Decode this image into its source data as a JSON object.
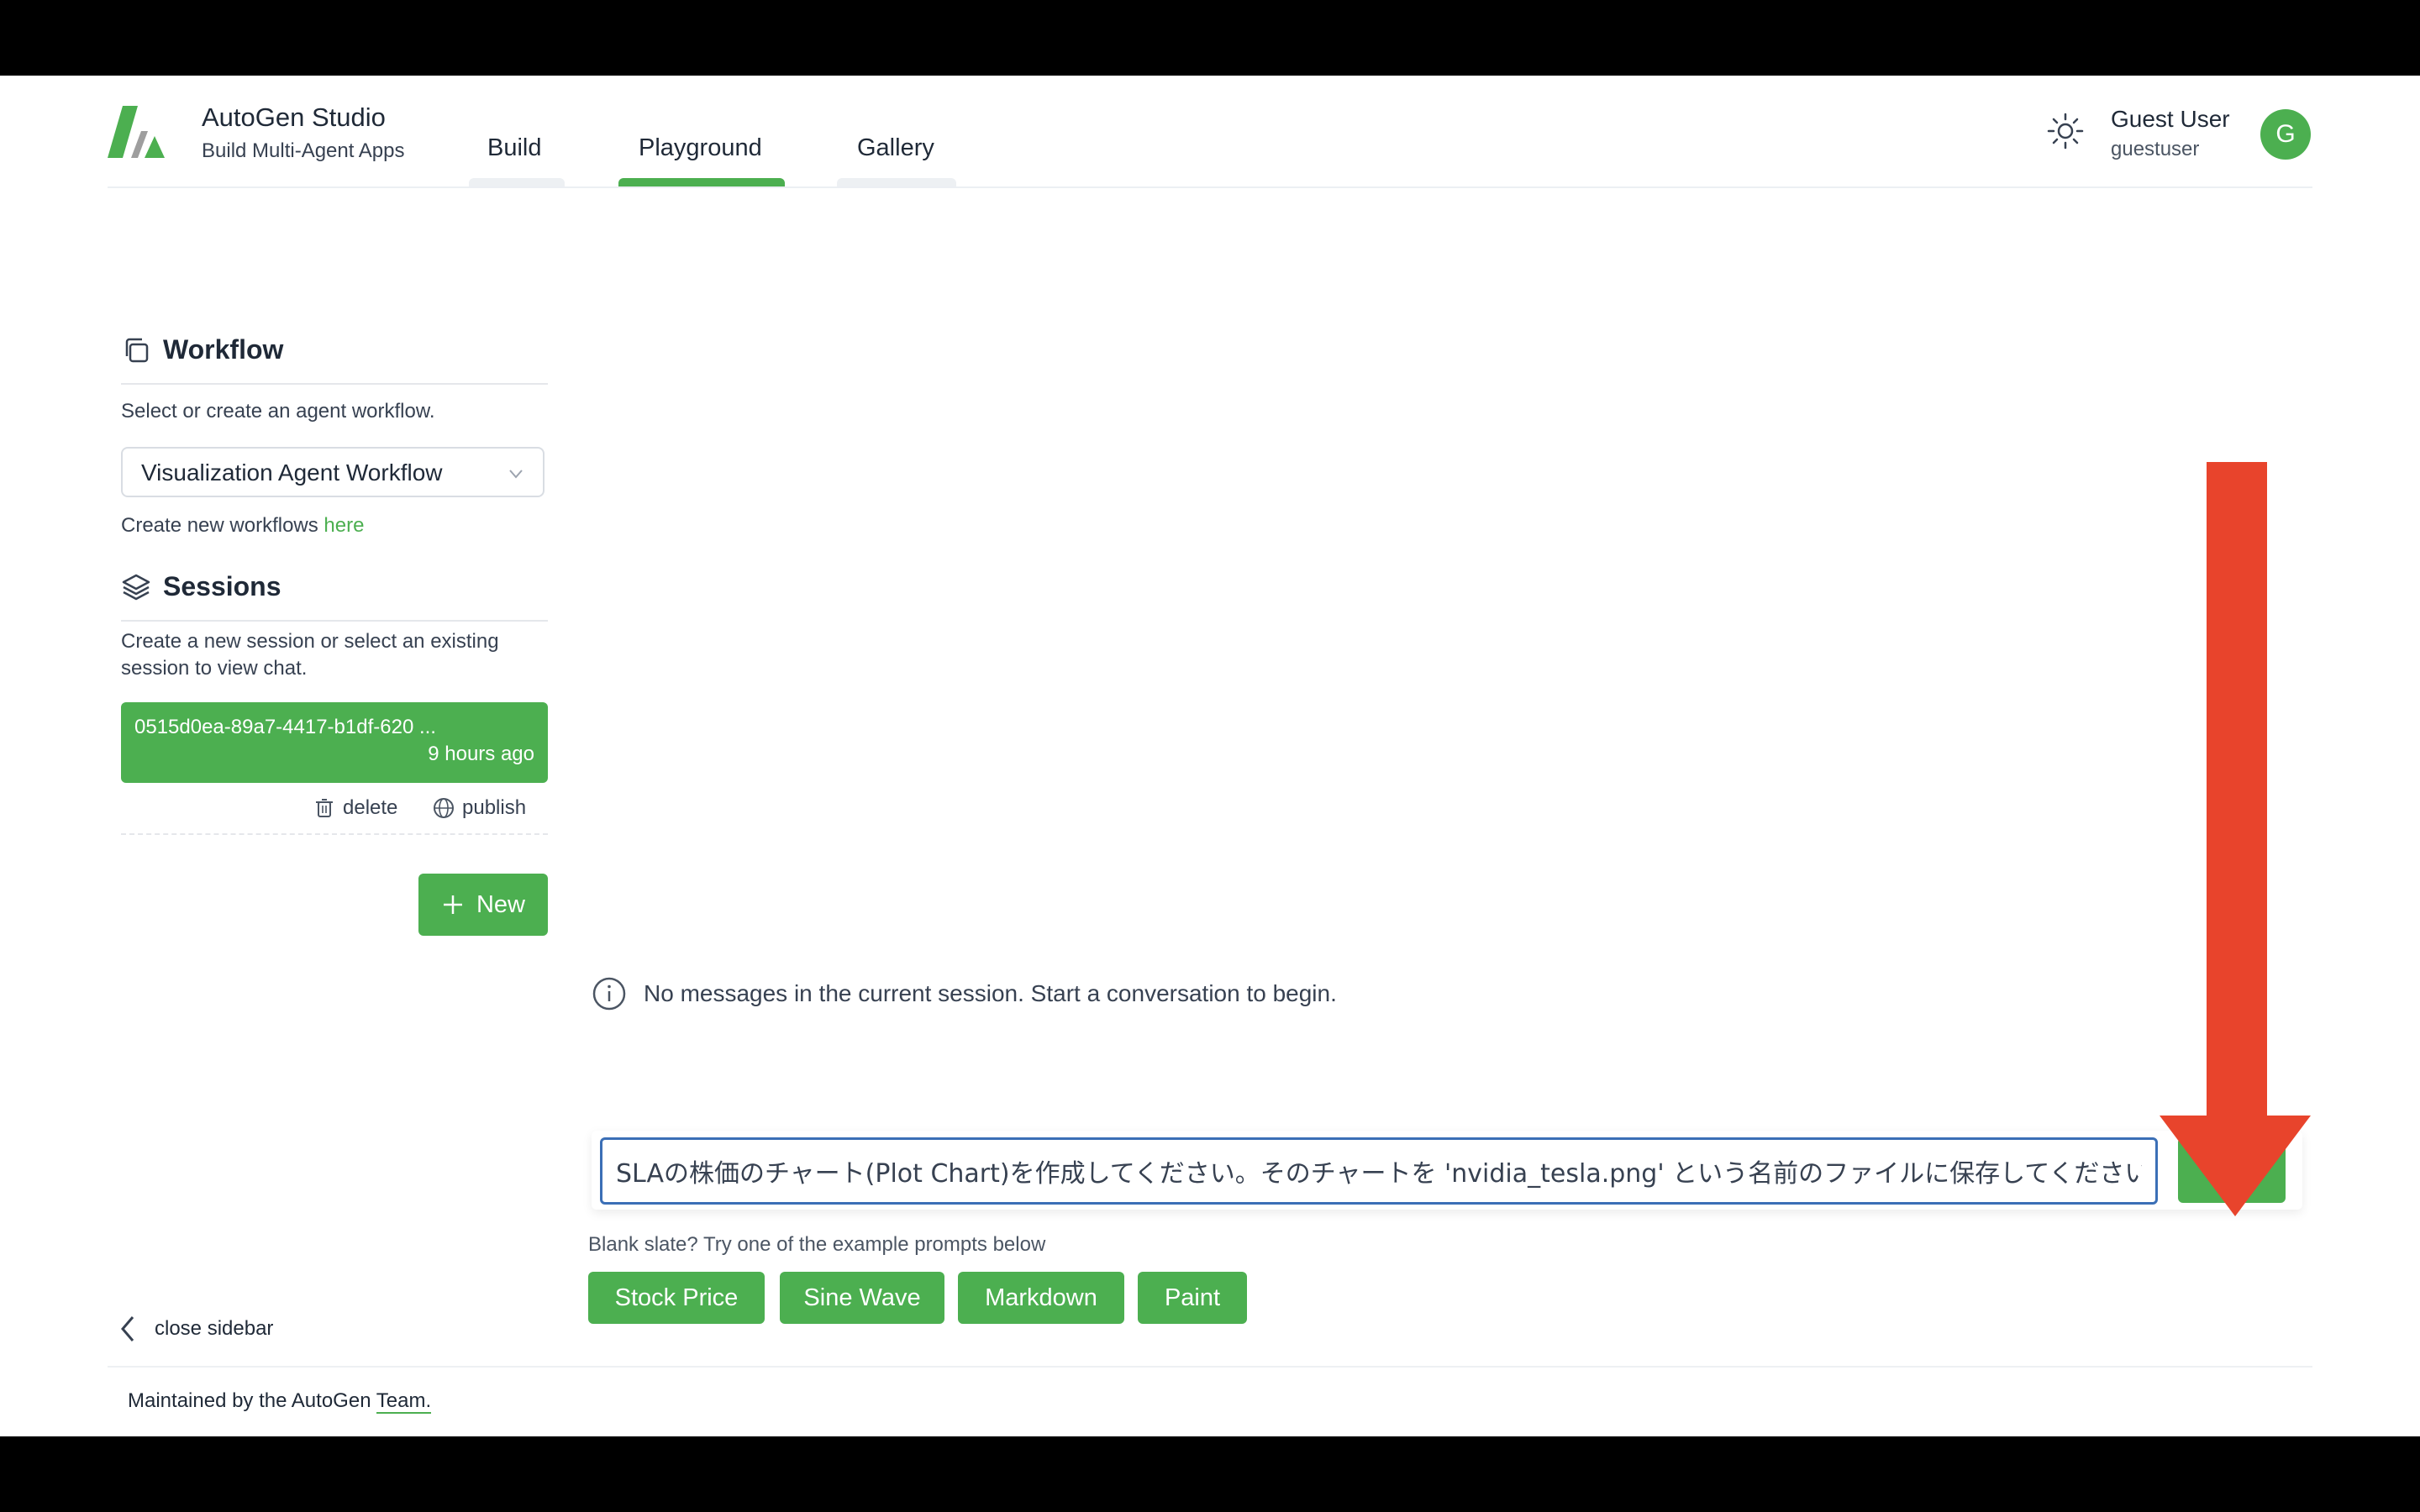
{
  "app": {
    "title": "AutoGen Studio",
    "subtitle": "Build Multi-Agent Apps"
  },
  "nav": {
    "tabs": [
      {
        "label": "Build",
        "active": false
      },
      {
        "label": "Playground",
        "active": true
      },
      {
        "label": "Gallery",
        "active": false
      }
    ]
  },
  "user": {
    "name": "Guest User",
    "handle": "guestuser",
    "avatar_letter": "G"
  },
  "sidebar": {
    "workflow": {
      "heading": "Workflow",
      "description": "Select or create an agent workflow.",
      "selected": "Visualization Agent Workflow",
      "create_text": "Create new workflows ",
      "create_link": "here"
    },
    "sessions": {
      "heading": "Sessions",
      "description": "Create a new session or select an existing session to view chat.",
      "items": [
        {
          "id": "0515d0ea-89a7-4417-b1df-620 ...",
          "time": "9 hours ago"
        }
      ],
      "delete_label": "delete",
      "publish_label": "publish",
      "new_button": "New"
    },
    "close_label": "close sidebar"
  },
  "main": {
    "empty_message": "No messages in the current session. Start a conversation to begin.",
    "input_value": "SLAの株価のチャート(Plot Chart)を作成してください。そのチャートを 'nvidia_tesla.png' という名前のファイルに保存してください。",
    "blank_hint": "Blank slate? Try one of the example prompts below",
    "examples": [
      "Stock Price",
      "Sine Wave",
      "Markdown",
      "Paint"
    ]
  },
  "footer": {
    "text": "Maintained by the AutoGen ",
    "link": "Team."
  },
  "colors": {
    "accent": "#4caf50",
    "annotation": "#e8442c",
    "input_border": "#3b6fb6"
  },
  "icons": {
    "theme": "sun-icon",
    "workflow": "copy-icon",
    "sessions": "layers-icon",
    "info": "info-icon",
    "send": "send-icon",
    "delete": "trash-icon",
    "publish": "globe-icon",
    "new": "plus-icon",
    "close": "chevron-left-icon"
  }
}
